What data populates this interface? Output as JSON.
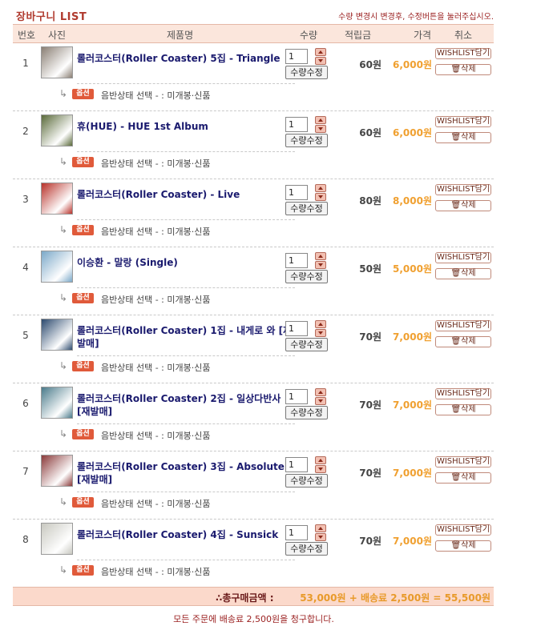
{
  "title": "장바구니 LIST",
  "notice": "수량 변경시 변경후, 수정버튼을 눌러주십시오.",
  "columns": {
    "num": "번호",
    "photo": "사진",
    "name": "제품명",
    "qty": "수량",
    "points": "적립금",
    "price": "가격",
    "cancel": "취소"
  },
  "buttons": {
    "update_qty": "수량수정",
    "wishlist": "WISHLIST담기",
    "delete": "삭제"
  },
  "option": {
    "badge": "옵션",
    "text": "음반상태 선택 - : 미개봉·신품"
  },
  "colors": {
    "accent": "#b03a2e",
    "price": "#f0a030",
    "header_bg": "#fbe6dc",
    "total_bg": "#fbd9cb"
  },
  "items": [
    {
      "num": "1",
      "name": "롤러코스터(Roller Coaster) 5집 - Triangle",
      "qty": "1",
      "points": "60원",
      "price": "6,000원",
      "thumb_color": "#8a7f74"
    },
    {
      "num": "2",
      "name": "휴(HUE) - HUE 1st Album",
      "qty": "1",
      "points": "60원",
      "price": "6,000원",
      "thumb_color": "#5a6a3a"
    },
    {
      "num": "3",
      "name": "롤러코스터(Roller Coaster) - Live",
      "qty": "1",
      "points": "80원",
      "price": "8,000원",
      "thumb_color": "#b8322a"
    },
    {
      "num": "4",
      "name": "이승환 - 말랑 (Single)",
      "qty": "1",
      "points": "50원",
      "price": "5,000원",
      "thumb_color": "#7aa8c8"
    },
    {
      "num": "5",
      "name": "롤러코스터(Roller Coaster) 1집 - 내게로 와 [재발매]",
      "qty": "1",
      "points": "70원",
      "price": "7,000원",
      "thumb_color": "#2c4a6e"
    },
    {
      "num": "6",
      "name": "롤러코스터(Roller Coaster) 2집 - 일상다반사 [재발매]",
      "qty": "1",
      "points": "70원",
      "price": "7,000원",
      "thumb_color": "#4a7a8a"
    },
    {
      "num": "7",
      "name": "롤러코스터(Roller Coaster) 3집 - Absolute [재발매]",
      "qty": "1",
      "points": "70원",
      "price": "7,000원",
      "thumb_color": "#8a3a3a"
    },
    {
      "num": "8",
      "name": "롤러코스터(Roller Coaster) 4집 - Sunsick",
      "qty": "1",
      "points": "70원",
      "price": "7,000원",
      "thumb_color": "#c8c8c0"
    }
  ],
  "total": {
    "label": "∴총구매금액 :",
    "value": "53,000원 + 배송료 2,500원 = 55,500원"
  },
  "footer": "모든 주문에 배송료 2,500원을 청구합니다."
}
